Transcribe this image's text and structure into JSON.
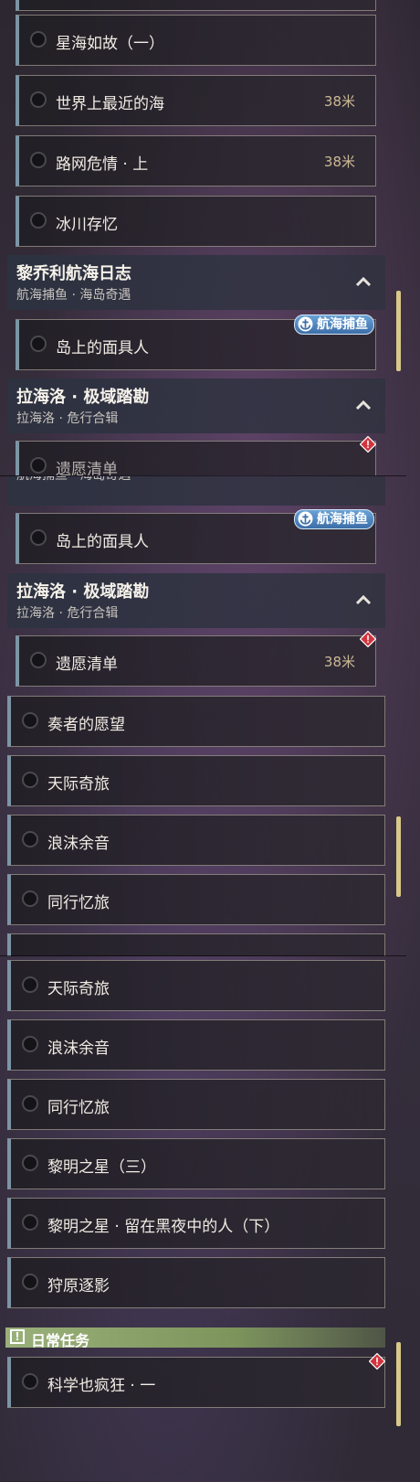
{
  "panel1": {
    "items": [
      {
        "label": "星海如故（一）",
        "distance": ""
      },
      {
        "label": "世界上最近的海",
        "distance": "38米"
      },
      {
        "label": "路网危情 · 上",
        "distance": "38米"
      },
      {
        "label": "冰川存忆",
        "distance": ""
      }
    ],
    "group1": {
      "title": "黎乔利航海日志",
      "subtitle": "航海捕鱼 · 海岛奇遇"
    },
    "group1_item": {
      "label": "岛上的面具人",
      "badge": "航海捕鱼"
    },
    "group2": {
      "title": "拉海洛 · 极域踏勘",
      "subtitle": "拉海洛 · 危行合辑"
    },
    "partial_label": "遗愿清单"
  },
  "panel2": {
    "partial_subtitle": "航海捕鱼 · 海岛奇遇",
    "group1_item": {
      "label": "岛上的面具人",
      "badge": "航海捕鱼"
    },
    "group2": {
      "title": "拉海洛 · 极域踏勘",
      "subtitle": "拉海洛 · 危行合辑"
    },
    "group2_item": {
      "label": "遗愿清单",
      "distance": "38米"
    },
    "items": [
      {
        "label": "奏者的愿望"
      },
      {
        "label": "天际奇旅"
      },
      {
        "label": "浪沫余音"
      },
      {
        "label": "同行忆旅"
      }
    ]
  },
  "panel3": {
    "items": [
      {
        "label": "天际奇旅"
      },
      {
        "label": "浪沫余音"
      },
      {
        "label": "同行忆旅"
      },
      {
        "label": "黎明之星（三）"
      },
      {
        "label": "黎明之星 · 留在黑夜中的人（下）"
      },
      {
        "label": "狩原逐影"
      }
    ],
    "daily": {
      "label": "日常任务",
      "icon": "!"
    },
    "daily_item": {
      "label": "科学也疯狂 · 一"
    }
  },
  "colors": {
    "accent_blue": "#5a8fc8",
    "distance": "#cbb995",
    "daily_green": "#8ea46c",
    "alert_red": "#d2343e",
    "scrollbar": "#d8c98a"
  }
}
